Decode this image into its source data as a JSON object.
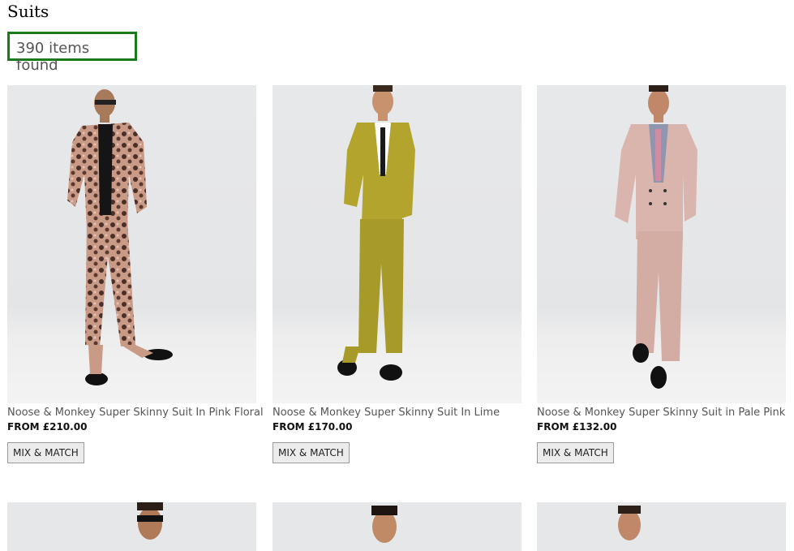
{
  "page": {
    "title": "Suits"
  },
  "results": {
    "count_text": "390 items found"
  },
  "products": [
    {
      "name": "Noose & Monkey Super Skinny Suit In Pink Floral",
      "price": "FROM £210.00",
      "button": "MIX & MATCH",
      "suit_color": "#b58a78",
      "pattern": "floral"
    },
    {
      "name": "Noose & Monkey Super Skinny Suit In Lime",
      "price": "FROM £170.00",
      "button": "MIX & MATCH",
      "suit_color": "#b3a42e",
      "pattern": "solid"
    },
    {
      "name": "Noose & Monkey Super Skinny Suit in Pale Pink",
      "price": "FROM £132.00",
      "button": "MIX & MATCH",
      "suit_color": "#d9b5ae",
      "pattern": "solid"
    }
  ],
  "colors": {
    "highlight_border": "#1a7a1a"
  }
}
